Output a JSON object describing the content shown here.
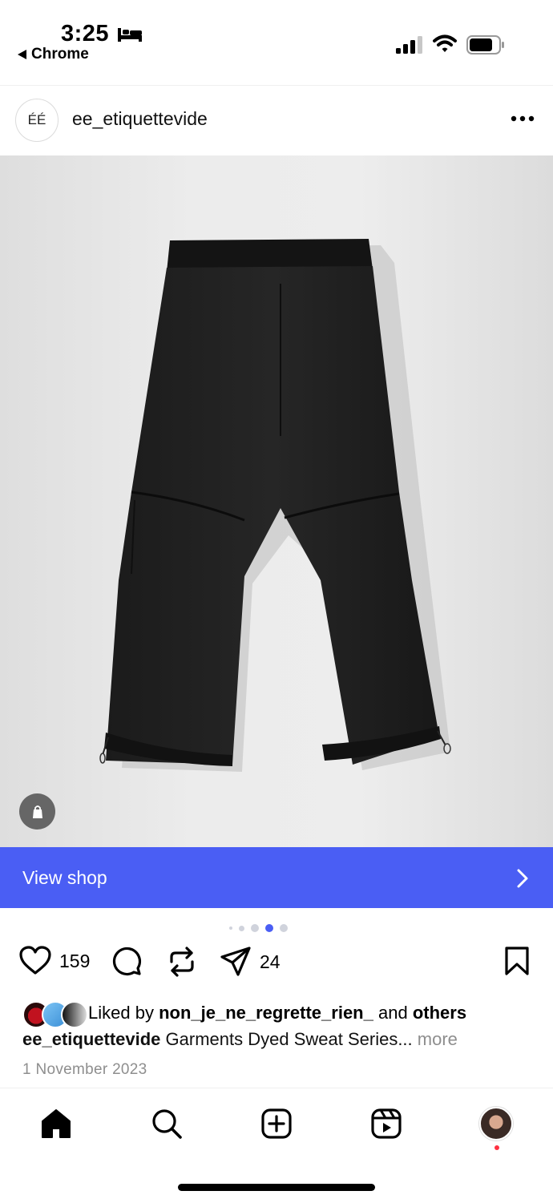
{
  "status_bar": {
    "time": "3:25",
    "back_app": "Chrome",
    "icons": [
      "bed-icon",
      "signal-icon",
      "wifi-icon",
      "battery-icon"
    ]
  },
  "post": {
    "username": "ee_etiquettevide",
    "avatar_text": "ÉÉ",
    "menu_icon": "more-icon",
    "media_icon": "shopping-bag-icon",
    "view_shop_label": "View shop",
    "carousel": {
      "count": 5,
      "active_index": 3
    },
    "likes_count": "159",
    "shares_count": "24",
    "liked_by_prefix": "Liked by",
    "liked_by_user": "non_je_ne_regrette_rien_",
    "liked_by_and": "and",
    "liked_by_others": "others",
    "caption_user": "ee_etiquettevide",
    "caption_text": "Garments Dyed Sweat Series...",
    "caption_more": "more",
    "date": "1 November 2023"
  },
  "actions": [
    "heart-icon",
    "comment-icon",
    "repost-icon",
    "share-icon",
    "bookmark-icon"
  ],
  "bottom_nav": [
    "home-icon",
    "search-icon",
    "create-icon",
    "reels-icon",
    "profile-avatar"
  ],
  "colors": {
    "accent": "#4a5ef4",
    "notification": "#ff3040",
    "muted_text": "#8e8e8e"
  }
}
